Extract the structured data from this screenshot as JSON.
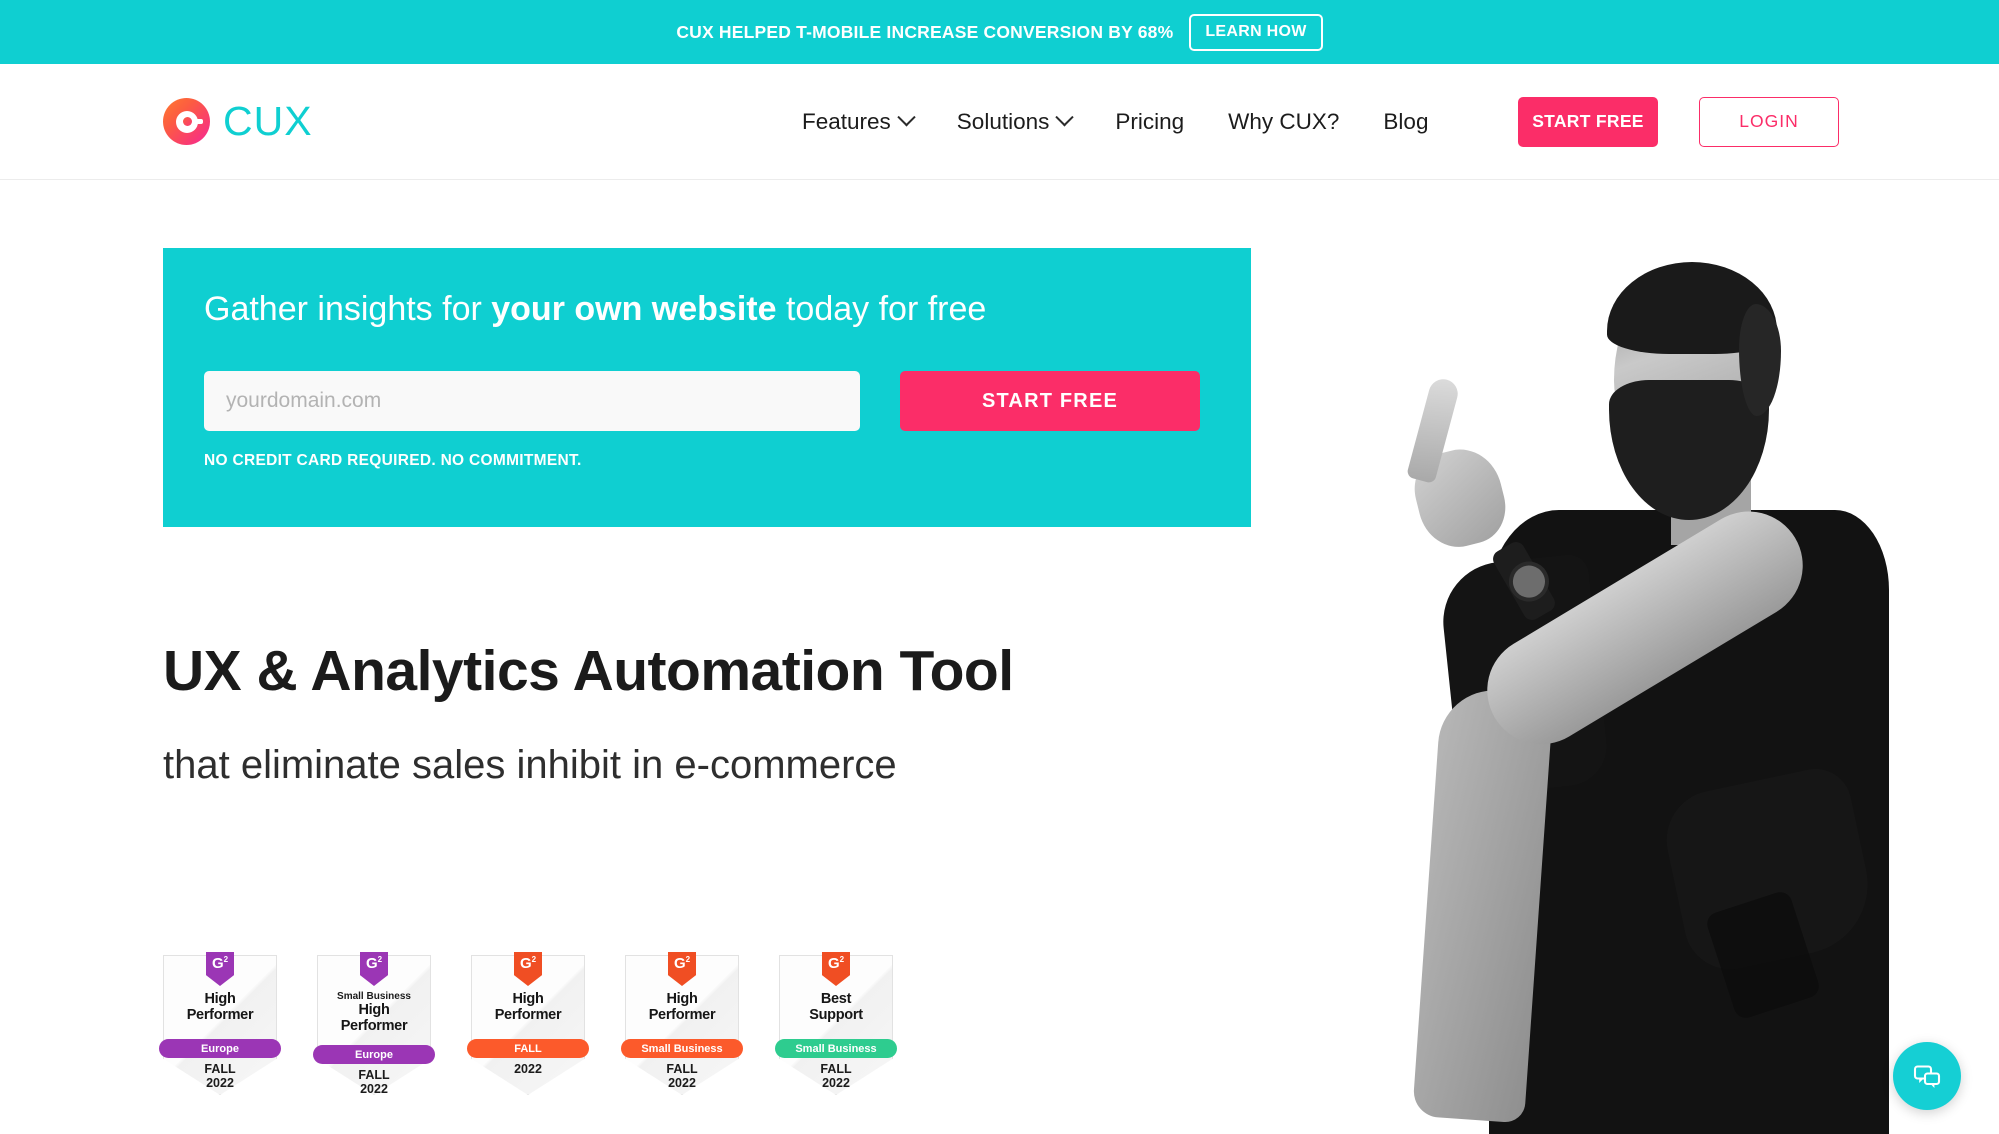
{
  "announcement": {
    "text": "CUX HELPED T-MOBILE INCREASE CONVERSION BY 68%",
    "cta_label": "LEARN HOW",
    "background": "#0FCFD1"
  },
  "header": {
    "logo_text": "CUX",
    "nav": [
      {
        "label": "Features",
        "has_dropdown": true
      },
      {
        "label": "Solutions",
        "has_dropdown": true
      },
      {
        "label": "Pricing",
        "has_dropdown": false
      },
      {
        "label": "Why CUX?",
        "has_dropdown": false
      },
      {
        "label": "Blog",
        "has_dropdown": false
      }
    ],
    "start_free_label": "START FREE",
    "login_label": "LOGIN",
    "accent_pink": "#FB2D68",
    "accent_teal": "#0FCFD1"
  },
  "signup": {
    "title_prefix": "Gather insights for ",
    "title_bold": "your own website",
    "title_suffix": " today for free",
    "input_placeholder": "yourdomain.com",
    "input_value": "",
    "submit_label": "START FREE",
    "fine_print": "NO CREDIT CARD REQUIRED. NO COMMITMENT."
  },
  "hero": {
    "headline": "UX & Analytics Automation Tool",
    "subheadline": "that eliminate sales inhibit in e-commerce"
  },
  "badges": [
    {
      "g2_label": "G",
      "g2_sup": "2",
      "g2_color": "#9B36B5",
      "small_top": "",
      "main": "High\nPerformer",
      "ribbon_text": "Europe",
      "ribbon_color": "#9B36B5",
      "bottom": "FALL\n2022"
    },
    {
      "g2_label": "G",
      "g2_sup": "2",
      "g2_color": "#9B36B5",
      "small_top": "Small Business",
      "main": "High\nPerformer",
      "ribbon_text": "Europe",
      "ribbon_color": "#9B36B5",
      "bottom": "FALL\n2022"
    },
    {
      "g2_label": "G",
      "g2_sup": "2",
      "g2_color": "#F04E23",
      "small_top": "",
      "main": "High\nPerformer",
      "ribbon_text": "FALL",
      "ribbon_color": "#FC5A2B",
      "bottom": "2022"
    },
    {
      "g2_label": "G",
      "g2_sup": "2",
      "g2_color": "#F04E23",
      "small_top": "",
      "main": "High\nPerformer",
      "ribbon_text": "Small Business",
      "ribbon_color": "#FC5A2B",
      "bottom": "FALL\n2022"
    },
    {
      "g2_label": "G",
      "g2_sup": "2",
      "g2_color": "#F04E23",
      "small_top": "",
      "main": "Best\nSupport",
      "ribbon_text": "Small Business",
      "ribbon_color": "#2ECC8F",
      "bottom": "FALL\n2022"
    }
  ],
  "chat": {
    "icon": "chat-bubbles-icon",
    "color": "#15CFD4"
  }
}
